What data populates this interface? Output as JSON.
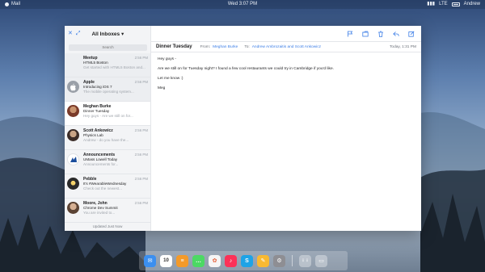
{
  "system_bar": {
    "app_label": "Mail",
    "clock": "Wed 3:07 PM",
    "status_text": "LTE",
    "user": "Andrew"
  },
  "toolbar": {
    "close_glyph": "✕",
    "expand_glyph": "⤢",
    "mailbox_label": "All Inboxes ▾",
    "icons": [
      "flag-icon",
      "folder-icon",
      "trash-icon",
      "reply-icon",
      "compose-icon"
    ]
  },
  "search": {
    "placeholder": "Search"
  },
  "messages": [
    {
      "sender": "Meetup",
      "subject": "HTML5 Boston",
      "preview": "Get started with HTML5 Boston and...",
      "time": "2:56 PM",
      "avatar": "none"
    },
    {
      "sender": "Apple",
      "subject": "Introducing iOS 7",
      "preview": "The mobile operating system...",
      "time": "2:56 PM",
      "avatar": "apple-logo"
    },
    {
      "sender": "Meghan Burke",
      "subject": "Dinner Tuesday",
      "preview": "Hey guys - Are we still on for...",
      "time": "",
      "avatar": "photo"
    },
    {
      "sender": "Scott Ankowicz",
      "subject": "Physics Lab",
      "preview": "Andrew - do you have the...",
      "time": "2:56 PM",
      "avatar": "photo"
    },
    {
      "sender": "Announcements",
      "subject": "UMass Lowell Today",
      "preview": "Announcements for...",
      "time": "2:56 PM",
      "avatar": "umass-logo"
    },
    {
      "sender": "Pebble",
      "subject": "It's #WearableWednesday",
      "preview": "Check out the newest...",
      "time": "2:56 PM",
      "avatar": "pebble-logo"
    },
    {
      "sender": "Moore, John",
      "subject": "Chrome Dev Summit",
      "preview": "You are invited to...",
      "time": "2:56 PM",
      "avatar": "photo"
    }
  ],
  "sidebar_footer": "Updated Just Now",
  "reader": {
    "subject": "Dinner Tuesday",
    "from_label": "From:",
    "from": "Meghan Burke",
    "to_label": "To:",
    "to": "Andrew Ambrozaitis and Scott Ankowicz",
    "date": "Today, 1:31 PM",
    "body": [
      "Hey guys -",
      "Are we still on for Tuesday night? I found a few cool restaurants we could try in Cambridge if you'd like.",
      "Let me know :)",
      "Meg"
    ]
  },
  "dock": {
    "apps": [
      {
        "name": "mail",
        "color": "#3b8ff0",
        "glyph": "✉"
      },
      {
        "name": "calendar",
        "color": "#ffffff",
        "glyph": "10"
      },
      {
        "name": "reminders",
        "color": "#f39a2a",
        "glyph": "≡"
      },
      {
        "name": "messages",
        "color": "#4cd964",
        "glyph": "…"
      },
      {
        "name": "photos",
        "color": "#f5f5f5",
        "glyph": "✿"
      },
      {
        "name": "music",
        "color": "#fc3158",
        "glyph": "♪"
      },
      {
        "name": "skype",
        "color": "#1ea3e6",
        "glyph": "S"
      },
      {
        "name": "notes",
        "color": "#f8b932",
        "glyph": "✎"
      },
      {
        "name": "settings",
        "color": "#8e8e93",
        "glyph": "⚙"
      }
    ],
    "utilities": [
      {
        "name": "launchpad",
        "glyph": "⋮⋮"
      },
      {
        "name": "windows",
        "glyph": "▭"
      }
    ]
  }
}
